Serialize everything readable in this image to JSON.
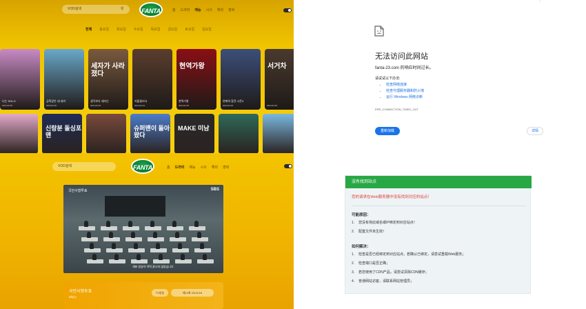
{
  "top_site": {
    "search_placeholder": "VOD검색",
    "logo_text": "FANTA",
    "nav": [
      "홈",
      "드라마",
      "예능",
      "시사",
      "해외",
      "영화"
    ],
    "nav_active": "예능",
    "categories": [
      "전체",
      "동요일",
      "화요일",
      "수요일",
      "목요일",
      "금요일",
      "토요일",
      "일요일"
    ],
    "row1": [
      {
        "title": "",
        "caption": "나는 SOLO",
        "date": "2024.02.06",
        "color": "#c88bc4"
      },
      {
        "title": "",
        "caption": "금쪽같은 내 새끼",
        "date": "2024.02.06",
        "color": "#6aa9c9"
      },
      {
        "title": "세자가 사라졌다",
        "caption": "생각보다 세자는",
        "date": "2024.02.03",
        "color": "#7a5a3e"
      },
      {
        "title": "",
        "caption": "커플클리닉",
        "date": "2024.02.04",
        "color": "#5b3e2e"
      },
      {
        "title": "현역가왕",
        "caption": "현역가왕",
        "date": "2024.02.06",
        "color": "#8a0f15"
      },
      {
        "title": "",
        "caption": "연애의 참견 시즌3",
        "date": "2024.02.06",
        "color": "#3c4f7a"
      },
      {
        "title": "서거차",
        "caption": "",
        "date": "2024.02.06",
        "color": "#4a3a2e"
      }
    ],
    "row2": [
      {
        "title": "",
        "color": "#e3a9c9"
      },
      {
        "title": "신랑분 돌싱포맨",
        "color": "#1f2c56"
      },
      {
        "title": "",
        "color": "#7a4a3c"
      },
      {
        "title": "슈퍼맨이 돌아왔다",
        "color": "#4c7cc9"
      },
      {
        "title": "MAKE 미남",
        "color": "#2a2a2a"
      },
      {
        "title": "",
        "color": "#2e6a5a"
      },
      {
        "title": "",
        "color": "#7ab8e0"
      }
    ]
  },
  "bottom_site": {
    "search_placeholder": "VOD검색",
    "logo_text": "FANTA",
    "nav": [
      "홈",
      "드라마",
      "예능",
      "시사",
      "해외",
      "영화"
    ],
    "nav_active": "드라마",
    "video_title": "국민사형투표",
    "video_logo": "SBS",
    "video_subtitle": "개표 방송이 아직 끝나지 않았습니다.",
    "card_title": "국민사형투표",
    "card_date": "8화(2)",
    "card_btn1": "TV방송",
    "card_btn2": "제12화 23/11/16"
  },
  "browser_error": {
    "title": "无法访问此网站",
    "host_msg": "fanta-23.com 的响应时间过长。",
    "try_msg": "请试试以下办法:",
    "suggestions": [
      "检查网络连接",
      "检查代理服务器和防火墙",
      "运行 Windows 网络诊断"
    ],
    "error_code": "ERR_CONNECTION_TIMED_OUT",
    "reload_label": "重新加载",
    "details_label": "详情"
  },
  "not_found": {
    "header": "没有找到站点",
    "alert": "您的请求在Web服务器中没有找到对应的站点！",
    "reasons_title": "可能原因：",
    "reasons": [
      "1.",
      "2."
    ],
    "reasons_text": [
      "您没有将此域名或IP绑定到对应站点！",
      "配置文件未生效！"
    ],
    "fix_title": "如何解决：",
    "fix_numbers": [
      "1.",
      "2.",
      "3.",
      "4."
    ],
    "fix_text": [
      "检查是否已经绑定到对应站点，若确认已绑定，请尝试重载Web服务；",
      "检查端口是否正确；",
      "若您使用了CDN产品，请尝试清除CDN缓存；",
      "普通网站访客，请联系网站管理员；"
    ],
    "colors": {
      "header": "#27a844",
      "alert": "#e03c31"
    }
  }
}
